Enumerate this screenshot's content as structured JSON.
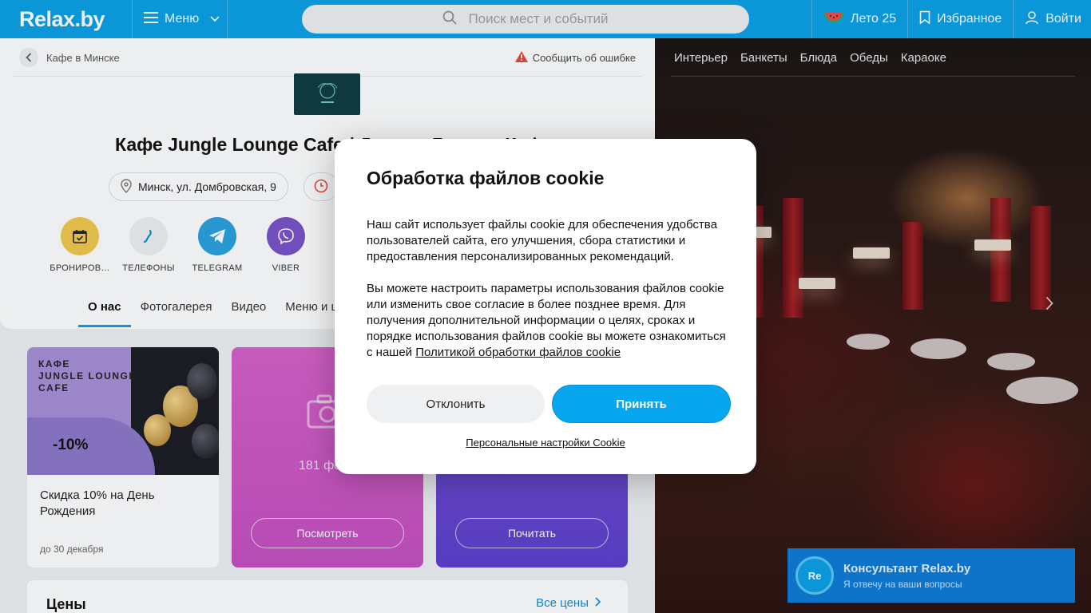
{
  "header": {
    "logo": "Relax.by",
    "menu_label": "Меню",
    "search_placeholder": "Поиск мест и событий",
    "summer_label": "Лето 25",
    "favorites_label": "Избранное",
    "login_label": "Войти",
    "brand_color": "#0aa0e6"
  },
  "breadcrumb": {
    "item": "Кафе в Минске",
    "report": "Сообщить об ошибке"
  },
  "venue": {
    "title": "Кафе Jungle Lounge Cafe / Джангл Лаундж Кафе",
    "address": "Минск, ул. Домбровская, 9"
  },
  "actions": [
    {
      "label": "БРОНИРОВ…",
      "icon": "calendar-check-icon",
      "color": "#f2c94c"
    },
    {
      "label": "ТЕЛЕФОНЫ",
      "icon": "phone-icon",
      "color": "#eef0f2"
    },
    {
      "label": "TELEGRAM",
      "icon": "telegram-icon",
      "color": "#2aa0de"
    },
    {
      "label": "VIBER",
      "icon": "viber-icon",
      "color": "#7a52c9"
    }
  ],
  "tabs": [
    "О нас",
    "Фотогалерея",
    "Видео",
    "Меню и цены"
  ],
  "promo": {
    "image_text": "КАФЕ\nJUNGLE LOUNGE\nCAFE",
    "discount": "-10%",
    "title": "Скидка 10% на День Рождения",
    "date": "до 30 декабря"
  },
  "photos_tile": {
    "count": "181 фото",
    "button": "Посмотреть"
  },
  "read_tile": {
    "button": "Почитать"
  },
  "prices": {
    "title": "Цены",
    "link": "Все цены"
  },
  "gallery": {
    "tabs": [
      "Интерьер",
      "Банкеты",
      "Блюда",
      "Обеды",
      "Караоке"
    ]
  },
  "consultant": {
    "avatar": "Re",
    "title": "Консультант Relax.by",
    "subtitle": "Я отвечу на ваши вопросы"
  },
  "cookie_modal": {
    "title": "Обработка файлов cookie",
    "paragraph1": "Наш сайт использует файлы cookie для обеспечения удобства пользователей сайта, его улучшения, сбора статистики и предоставления персонализированных рекомендаций.",
    "paragraph2": "Вы можете настроить параметры использования файлов cookie или изменить свое согласие в более позднее время. Для получения дополнительной информации о целях, сроках и порядке использования файлов cookie вы можете ознакомиться с нашей ",
    "policy_link": "Политикой обработки файлов cookie",
    "decline": "Отклонить",
    "accept": "Принять",
    "personal_settings": "Персональные настройки Cookie",
    "accent_color": "#06a7ee"
  }
}
